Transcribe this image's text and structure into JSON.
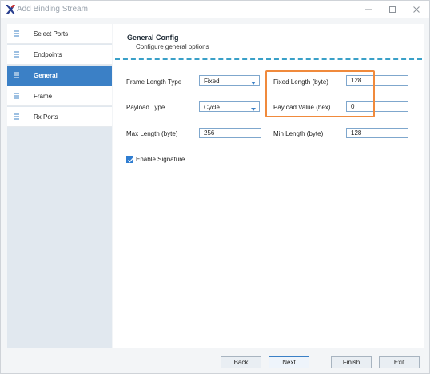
{
  "window": {
    "title": "Add Binding Stream",
    "app_icon": "x-logo-icon",
    "controls": {
      "minimize": "minimize-icon",
      "maximize": "maximize-icon",
      "close": "close-icon"
    }
  },
  "sidebar": {
    "items": [
      {
        "label": "Select Ports",
        "icon": "list-icon",
        "active": false
      },
      {
        "label": "Endpoints",
        "icon": "list-icon",
        "active": false
      },
      {
        "label": "General",
        "icon": "list-icon",
        "active": true
      },
      {
        "label": "Frame",
        "icon": "list-icon",
        "active": false
      },
      {
        "label": "Rx Ports",
        "icon": "list-icon",
        "active": false
      }
    ]
  },
  "main": {
    "title": "General Config",
    "subtitle": "Configure general options",
    "fields": {
      "frame_length_type": {
        "label": "Frame Length Type",
        "value": "Fixed"
      },
      "fixed_length": {
        "label": "Fixed Length (byte)",
        "value": "128"
      },
      "payload_type": {
        "label": "Payload Type",
        "value": "Cycle"
      },
      "payload_value": {
        "label": "Payload Value (hex)",
        "value": "0"
      },
      "max_length": {
        "label": "Max Length (byte)",
        "value": "256"
      },
      "min_length": {
        "label": "Min Length (byte)",
        "value": "128"
      }
    },
    "enable_signature": {
      "label": "Enable Signature",
      "checked": true
    }
  },
  "footer": {
    "back": "Back",
    "next": "Next",
    "finish": "Finish",
    "exit": "Exit"
  },
  "colors": {
    "accent": "#3b80c6",
    "highlight": "#f08a3c",
    "divider": "#3aa0c8",
    "logo": "#2a3f8f"
  }
}
